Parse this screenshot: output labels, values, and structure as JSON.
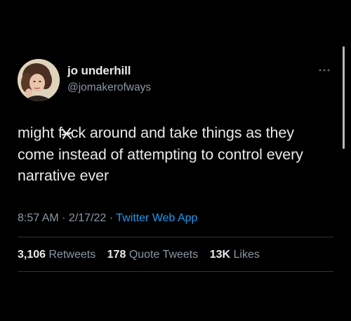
{
  "author": {
    "name": "jo underhill",
    "handle": "@jomakerofways"
  },
  "tweet": {
    "text_before": "might f",
    "text_censored": "u",
    "text_after": "ck around and take things as they come instead of attempting to control every narrative ever"
  },
  "meta": {
    "time": "8:57 AM",
    "sep1": " · ",
    "date": "2/17/22",
    "sep2": " · ",
    "source": "Twitter Web App"
  },
  "stats": {
    "retweets_count": "3,106",
    "retweets_label": "Retweets",
    "quotes_count": "178",
    "quotes_label": "Quote Tweets",
    "likes_count": "13K",
    "likes_label": "Likes"
  },
  "icons": {
    "more": "more-horizontal-icon",
    "avatar": "profile-photo"
  },
  "colors": {
    "background": "#000000",
    "text": "#e7e9ea",
    "secondary_text": "#8b98a5",
    "link": "#1d9bf0",
    "divider": "#2f3336"
  }
}
